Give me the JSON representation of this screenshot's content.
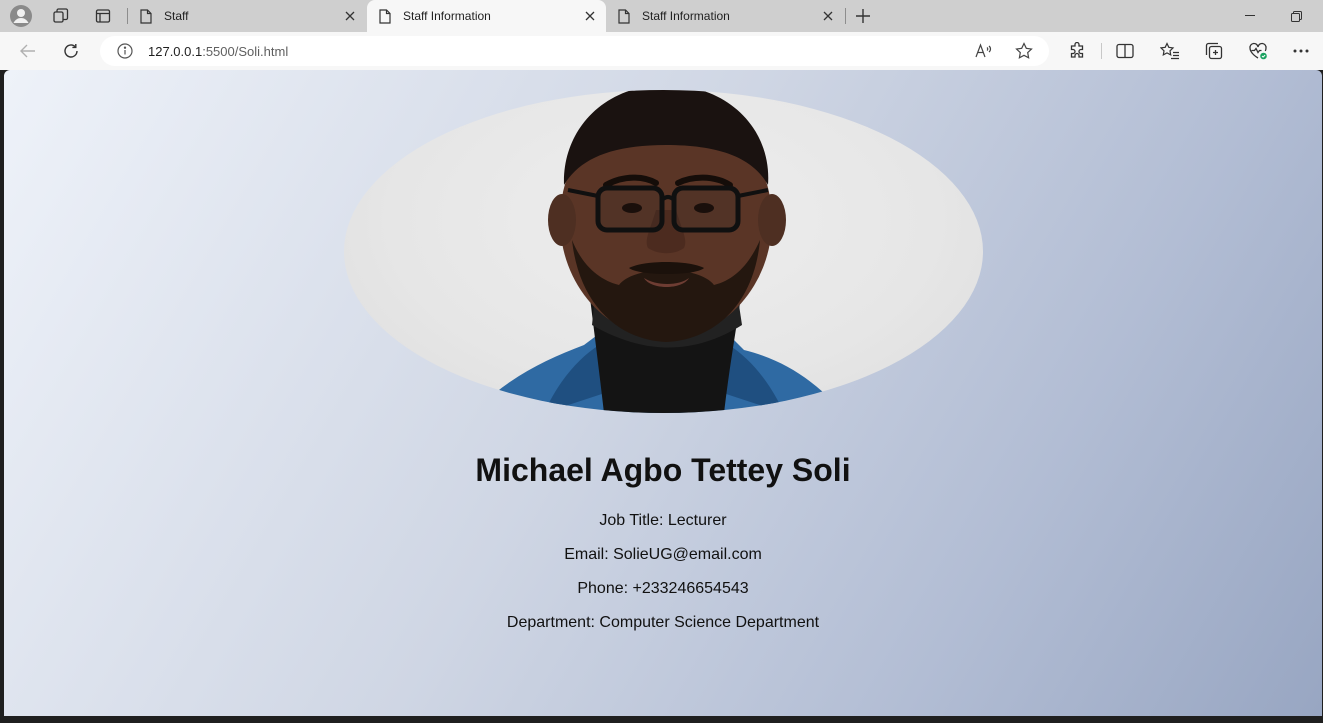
{
  "browser": {
    "tabs": [
      {
        "title": "Staff",
        "active": false
      },
      {
        "title": "Staff Information",
        "active": true
      },
      {
        "title": "Staff Information",
        "active": false
      }
    ],
    "address": {
      "host": "127.0.0.1",
      "rest": ":5500/Soli.html"
    },
    "colors": {
      "tabstrip": "#cfcfcf",
      "toolbar": "#f7f7f7",
      "accent_green": "#1aa260"
    }
  },
  "page": {
    "name": "Michael Agbo Tettey Soli",
    "job_title": "Job Title: Lecturer",
    "email": "Email: SolieUG@email.com",
    "phone": "Phone: +233246654543",
    "department": "Department: Computer Science Department",
    "photo_icon": "staff-portrait",
    "background_colors": [
      "#eef2f9",
      "#cfd6e4",
      "#b2bdd4",
      "#98a6c2"
    ]
  }
}
